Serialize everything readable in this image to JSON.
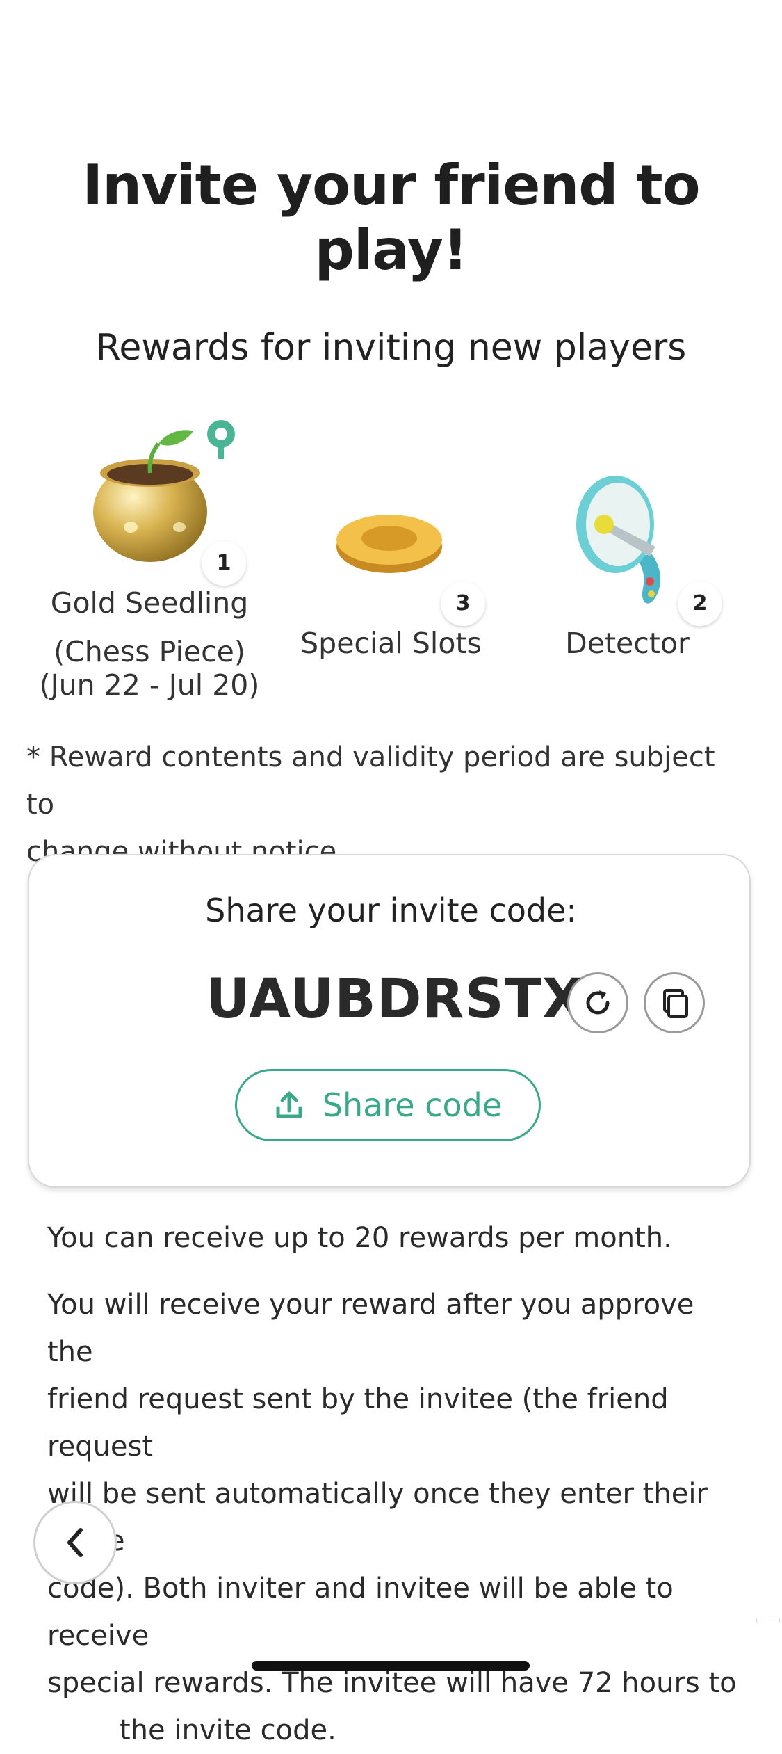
{
  "header": {
    "title": "Invite your friend to play!"
  },
  "rewards": {
    "heading": "Rewards for inviting new players",
    "items": [
      {
        "icon": "gold-seedling-pot",
        "count": "1",
        "label_lines": [
          "Gold Seedling",
          "(Chess Piece)",
          "(Jun 22 - Jul 20)"
        ]
      },
      {
        "icon": "special-slots-ring",
        "count": "3",
        "label_lines": [
          "Special Slots"
        ]
      },
      {
        "icon": "detector-speaker",
        "count": "2",
        "label_lines": [
          "Detector"
        ]
      }
    ],
    "notice_lines": [
      "* Reward contents and validity period are subject to",
      "change without notice."
    ]
  },
  "invite": {
    "heading": "Share your invite code:",
    "code": "UAUBDRSTX",
    "share_label": "Share code",
    "accent": "#3aa98a"
  },
  "info": {
    "limit": "You can receive up to 20 rewards per month.",
    "detail_lines": [
      "You will receive your reward after you approve the",
      "friend request sent by the invitee (the friend request",
      "will be sent automatically once they enter their invite",
      "code). Both inviter and invitee will be able to receive",
      "special rewards. The invitee will have 72 hours to",
      "the invite code."
    ]
  }
}
